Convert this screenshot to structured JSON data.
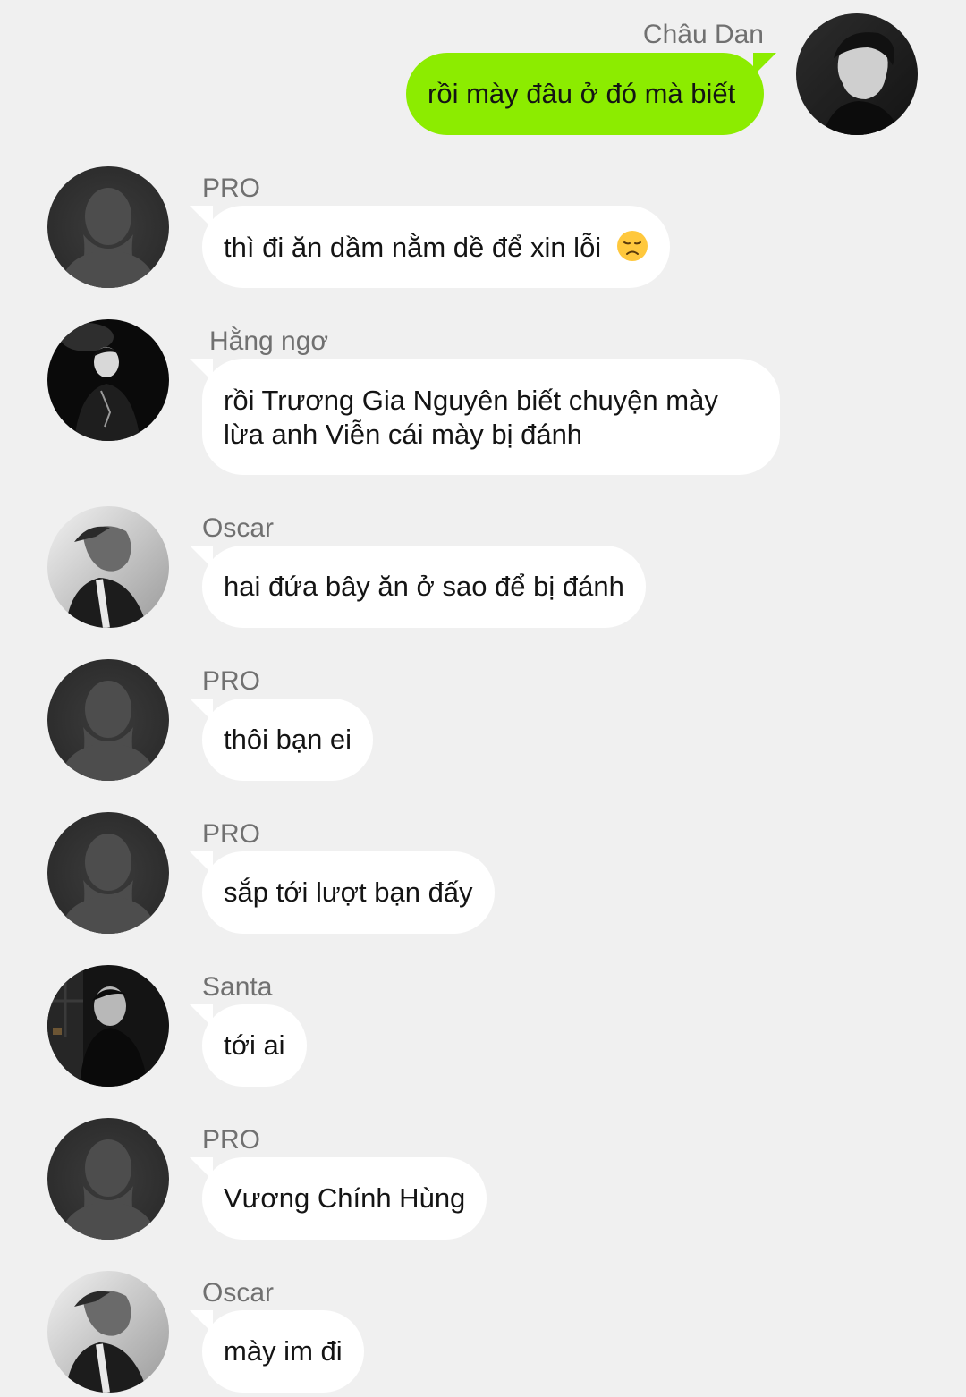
{
  "messages": [
    {
      "sender": "Châu Dan",
      "text": "rồi mày đâu ở đó mà biết",
      "outgoing": true,
      "avatar": "photo-avatar-chau-dan"
    },
    {
      "sender": "PRO",
      "text": "thì đi ăn dầm nằm dề để xin lỗi",
      "emoji": "disappointed-face-emoji",
      "avatar": "default-avatar"
    },
    {
      "sender": "Hằng ngơ",
      "text": "rồi Trương Gia Nguyên biết chuyện mày lừa anh Viễn cái mày bị đánh",
      "avatar": "photo-avatar-hang-ngo"
    },
    {
      "sender": "Oscar",
      "text": "hai đứa bây ăn ở sao để bị đánh",
      "avatar": "photo-avatar-oscar"
    },
    {
      "sender": "PRO",
      "text": "thôi bạn ei",
      "avatar": "default-avatar"
    },
    {
      "sender": "PRO",
      "text": "sắp tới lượt bạn đấy",
      "avatar": "default-avatar"
    },
    {
      "sender": "Santa",
      "text": "tới ai",
      "avatar": "photo-avatar-santa"
    },
    {
      "sender": "PRO",
      "text": "Vương Chính Hùng",
      "avatar": "default-avatar"
    },
    {
      "sender": "Oscar",
      "text": "mày im đi",
      "avatar": "photo-avatar-oscar"
    }
  ],
  "colors": {
    "background": "#f0f0f0",
    "outgoing_bubble": "#8cec00",
    "incoming_bubble": "#ffffff",
    "sender_name": "#707070"
  }
}
